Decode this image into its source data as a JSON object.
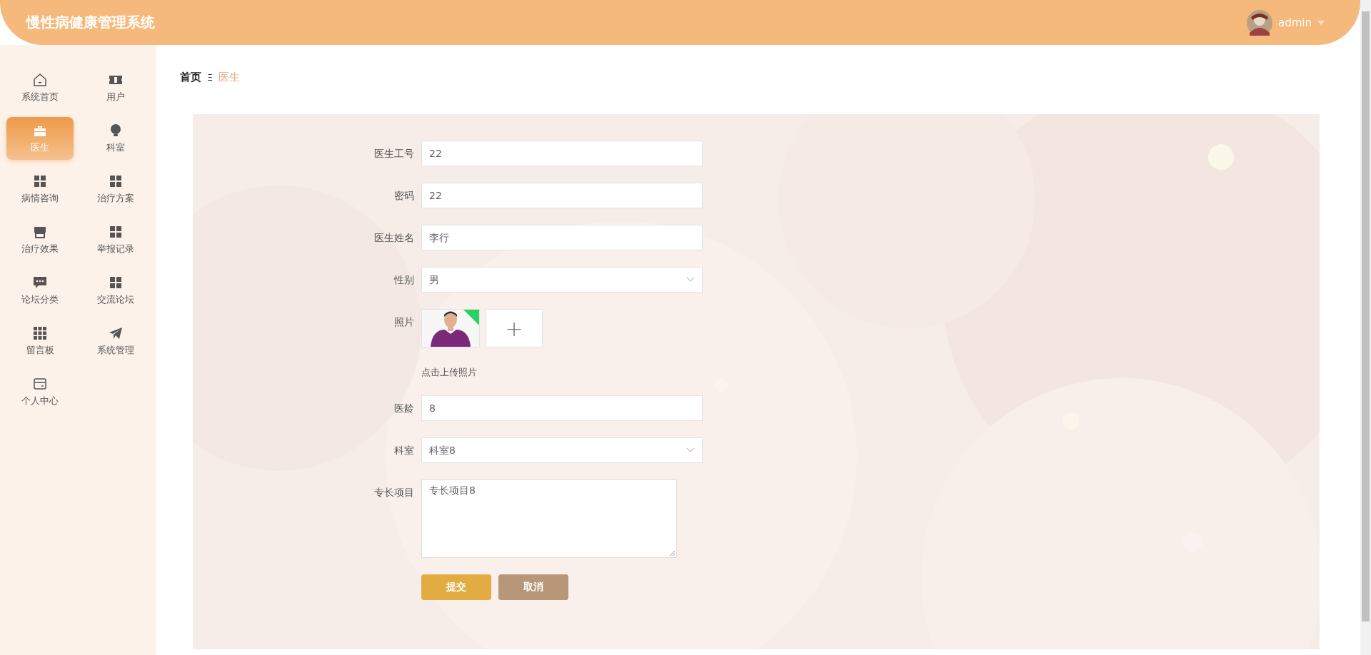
{
  "header": {
    "title": "慢性病健康管理系统",
    "user": "admin"
  },
  "sidebar": {
    "items": [
      {
        "label": "系统首页",
        "selected": false
      },
      {
        "label": "用户",
        "selected": false
      },
      {
        "label": "医生",
        "selected": true
      },
      {
        "label": "科室",
        "selected": false
      },
      {
        "label": "病情咨询",
        "selected": false
      },
      {
        "label": "治疗方案",
        "selected": false
      },
      {
        "label": "治疗效果",
        "selected": false
      },
      {
        "label": "举报记录",
        "selected": false
      },
      {
        "label": "论坛分类",
        "selected": false
      },
      {
        "label": "交流论坛",
        "selected": false
      },
      {
        "label": "留言板",
        "selected": false
      },
      {
        "label": "系统管理",
        "selected": false
      },
      {
        "label": "个人中心",
        "selected": false
      }
    ]
  },
  "breadcrumb": {
    "home": "首页",
    "separator": "Ξ",
    "current": "医生"
  },
  "form": {
    "fields": [
      {
        "kind": "text",
        "label": "医生工号",
        "value": "22"
      },
      {
        "kind": "text",
        "label": "密码",
        "value": "22"
      },
      {
        "kind": "text",
        "label": "医生姓名",
        "value": "李行"
      },
      {
        "kind": "select",
        "label": "性别",
        "value": "男"
      },
      {
        "kind": "upload",
        "label": "照片",
        "hint": "点击上传照片",
        "add": "+"
      },
      {
        "kind": "text",
        "label": "医龄",
        "value": "8"
      },
      {
        "kind": "select",
        "label": "科室",
        "value": "科室8"
      },
      {
        "kind": "textarea",
        "label": "专长项目",
        "value": "专长项目8"
      }
    ],
    "buttons": [
      {
        "kind": "primary",
        "label": "提交"
      },
      {
        "kind": "cancel",
        "label": "取消"
      }
    ]
  }
}
